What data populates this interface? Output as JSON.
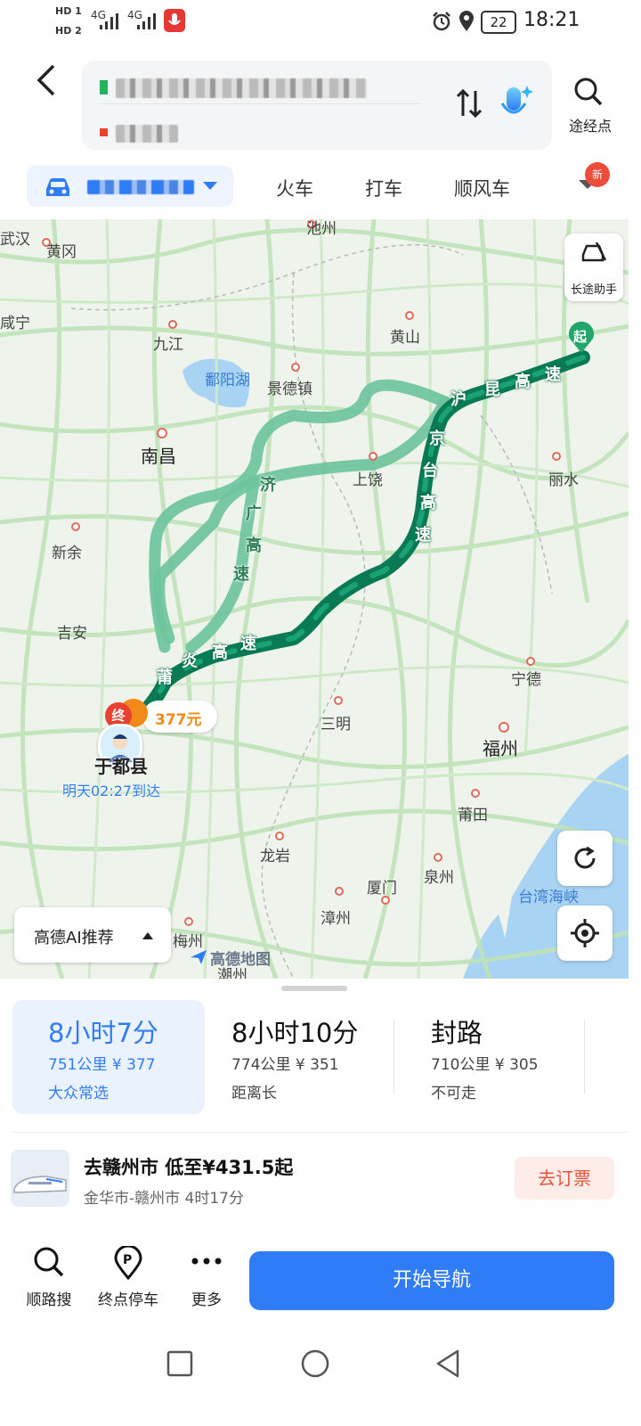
{
  "status_bar": {
    "hd1": "HD 1",
    "hd2": "HD 2",
    "sig1": "4G",
    "sig2": "4G",
    "battery": "22",
    "time": "18:21"
  },
  "header": {
    "waypoint_label": "途经点"
  },
  "modes": {
    "train": "火车",
    "taxi": "打车",
    "carpool": "顺风车",
    "new_badge": "新"
  },
  "map": {
    "cities": [
      {
        "id": "wuhan",
        "name": "武汉"
      },
      {
        "id": "huanggang",
        "name": "黄冈"
      },
      {
        "id": "chizhou",
        "name": "池州"
      },
      {
        "id": "xianning",
        "name": "咸宁"
      },
      {
        "id": "jiujiang",
        "name": "九江"
      },
      {
        "id": "huangshan",
        "name": "黄山"
      },
      {
        "id": "poyang",
        "name": "鄱阳湖"
      },
      {
        "id": "jingdezhen",
        "name": "景德镇"
      },
      {
        "id": "nanchang",
        "name": "南昌"
      },
      {
        "id": "shangrao",
        "name": "上饶"
      },
      {
        "id": "lishui",
        "name": "丽水"
      },
      {
        "id": "xinyu",
        "name": "新余"
      },
      {
        "id": "jian",
        "name": "吉安"
      },
      {
        "id": "ningde",
        "name": "宁德"
      },
      {
        "id": "sanming",
        "name": "三明"
      },
      {
        "id": "fuzhou",
        "name": "福州"
      },
      {
        "id": "putian",
        "name": "莆田"
      },
      {
        "id": "longyan",
        "name": "龙岩"
      },
      {
        "id": "xiamen",
        "name": "厦门"
      },
      {
        "id": "quanzhou",
        "name": "泉州"
      },
      {
        "id": "zhangzhou",
        "name": "漳州"
      },
      {
        "id": "meizhou",
        "name": "梅州"
      },
      {
        "id": "chaozhou",
        "name": "潮州"
      },
      {
        "id": "taiwan_strait",
        "name": "台湾海峡"
      }
    ],
    "roads": {
      "hukun": [
        "沪",
        "昆",
        "高",
        "速"
      ],
      "jingtai": [
        "京",
        "台",
        "高",
        "速"
      ],
      "jiguang": [
        "济",
        "广",
        "高",
        "速"
      ],
      "puyan": [
        "莆",
        "炎",
        "高",
        "速"
      ]
    },
    "start_marker": "起",
    "end_marker": "终",
    "toll": "377元",
    "destination": "于都县",
    "arrival": "明天02:27到达",
    "long_trip_helper": "长途助手",
    "ai_recommend": "高德AI推荐",
    "logo_text": "高德地图"
  },
  "routes": [
    {
      "time": "8小时7分",
      "detail": "751公里 ¥ 377",
      "tag": "大众常选"
    },
    {
      "time": "8小时10分",
      "detail": "774公里 ¥ 351",
      "tag": "距离长"
    },
    {
      "time": "封路",
      "detail": "710公里 ¥ 305",
      "tag": "不可走"
    }
  ],
  "train_offer": {
    "title": "去赣州市 低至¥431.5起",
    "subtitle": "金华市-赣州市 4时17分",
    "button": "去订票"
  },
  "toolbar": {
    "search_along": "顺路搜",
    "parking": "终点停车",
    "more": "更多",
    "start_nav": "开始导航"
  },
  "colors": {
    "route_main": "#0a7a55",
    "route_alt": "#5fbf93",
    "accent_blue": "#2f7cf6",
    "toll_orange": "#f28a1a"
  }
}
